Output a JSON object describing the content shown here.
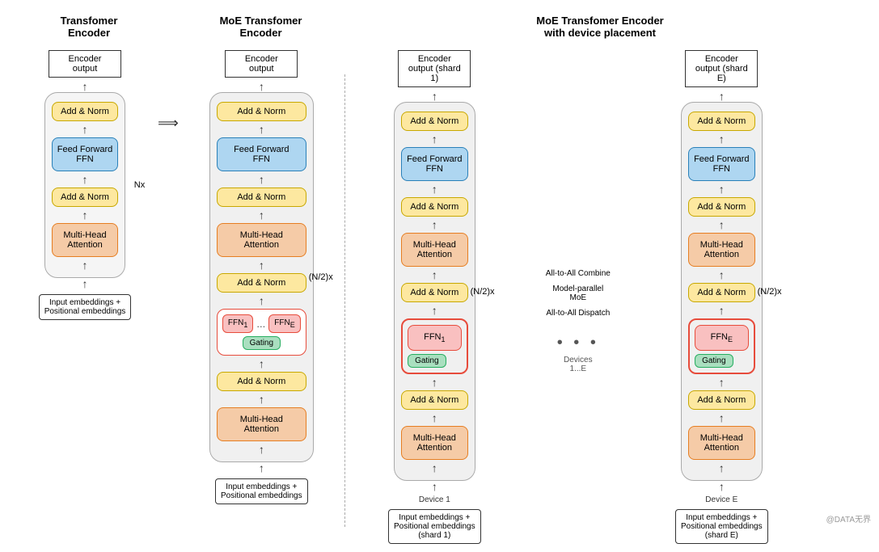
{
  "titles": {
    "transformer_encoder": "Transfomer\nEncoder",
    "moe_transformer_encoder": "MoE Transfomer\nEncoder",
    "moe_with_device": "MoE Transfomer Encoder\nwith device placement"
  },
  "transformer_enc": {
    "encoder_output": "Encoder\noutput",
    "add_norm_1": "Add & Norm",
    "feed_forward": "Feed Forward\nFFN",
    "add_norm_2": "Add & Norm",
    "multi_head": "Multi-Head\nAttention",
    "nx": "Nx",
    "input_embed": "Input embeddings +\nPositional embeddings"
  },
  "moe_enc": {
    "encoder_output": "Encoder\noutput",
    "add_norm_top": "Add & Norm",
    "feed_forward": "Feed Forward\nFFN",
    "add_norm_2": "Add & Norm",
    "multi_head": "Multi-Head\nAttention",
    "add_norm_3": "Add & Norm",
    "ffn1": "FFN₁",
    "ffn_dots": "...",
    "ffnE": "FFN_E",
    "gating": "Gating",
    "add_norm_4": "Add & Norm",
    "multi_head_2": "Multi-Head\nAttention",
    "nx": "(N/2)x",
    "input_embed": "Input embeddings +\nPositional embeddings"
  },
  "device1": {
    "encoder_output": "Encoder\noutput (shard 1)",
    "add_norm_top": "Add & Norm",
    "feed_forward": "Feed Forward\nFFN",
    "add_norm_2": "Add & Norm",
    "multi_head": "Multi-Head\nAttention",
    "add_norm_3": "Add & Norm",
    "ffn1": "FFN₁",
    "gating": "Gating",
    "add_norm_4": "Add & Norm",
    "multi_head_2": "Multi-Head\nAttention",
    "nx": "(N/2)x",
    "device_label": "Device 1",
    "input_embed": "Input embeddings +\nPositional embeddings\n(shard 1)"
  },
  "deviceE": {
    "encoder_output": "Encoder\noutput (shard E)",
    "add_norm_top": "Add & Norm",
    "feed_forward": "Feed Forward\nFFN",
    "add_norm_2": "Add & Norm",
    "multi_head": "Multi-Head\nAttention",
    "add_norm_3": "Add & Norm",
    "ffnE": "FFN_E",
    "gating": "Gating",
    "add_norm_4": "Add & Norm",
    "multi_head_2": "Multi-Head\nAttention",
    "nx": "(N/2)x",
    "device_label": "Device E",
    "input_embed": "Input embeddings +\nPositional embeddings\n(shard E)"
  },
  "middle_labels": {
    "all_to_all_combine": "All-to-All Combine",
    "model_parallel_moe": "Model-parallel\nMoE",
    "all_to_all_dispatch": "All-to-All Dispatch",
    "devices_label": "Devices\n1...E"
  },
  "watermark": "@DATA无界"
}
